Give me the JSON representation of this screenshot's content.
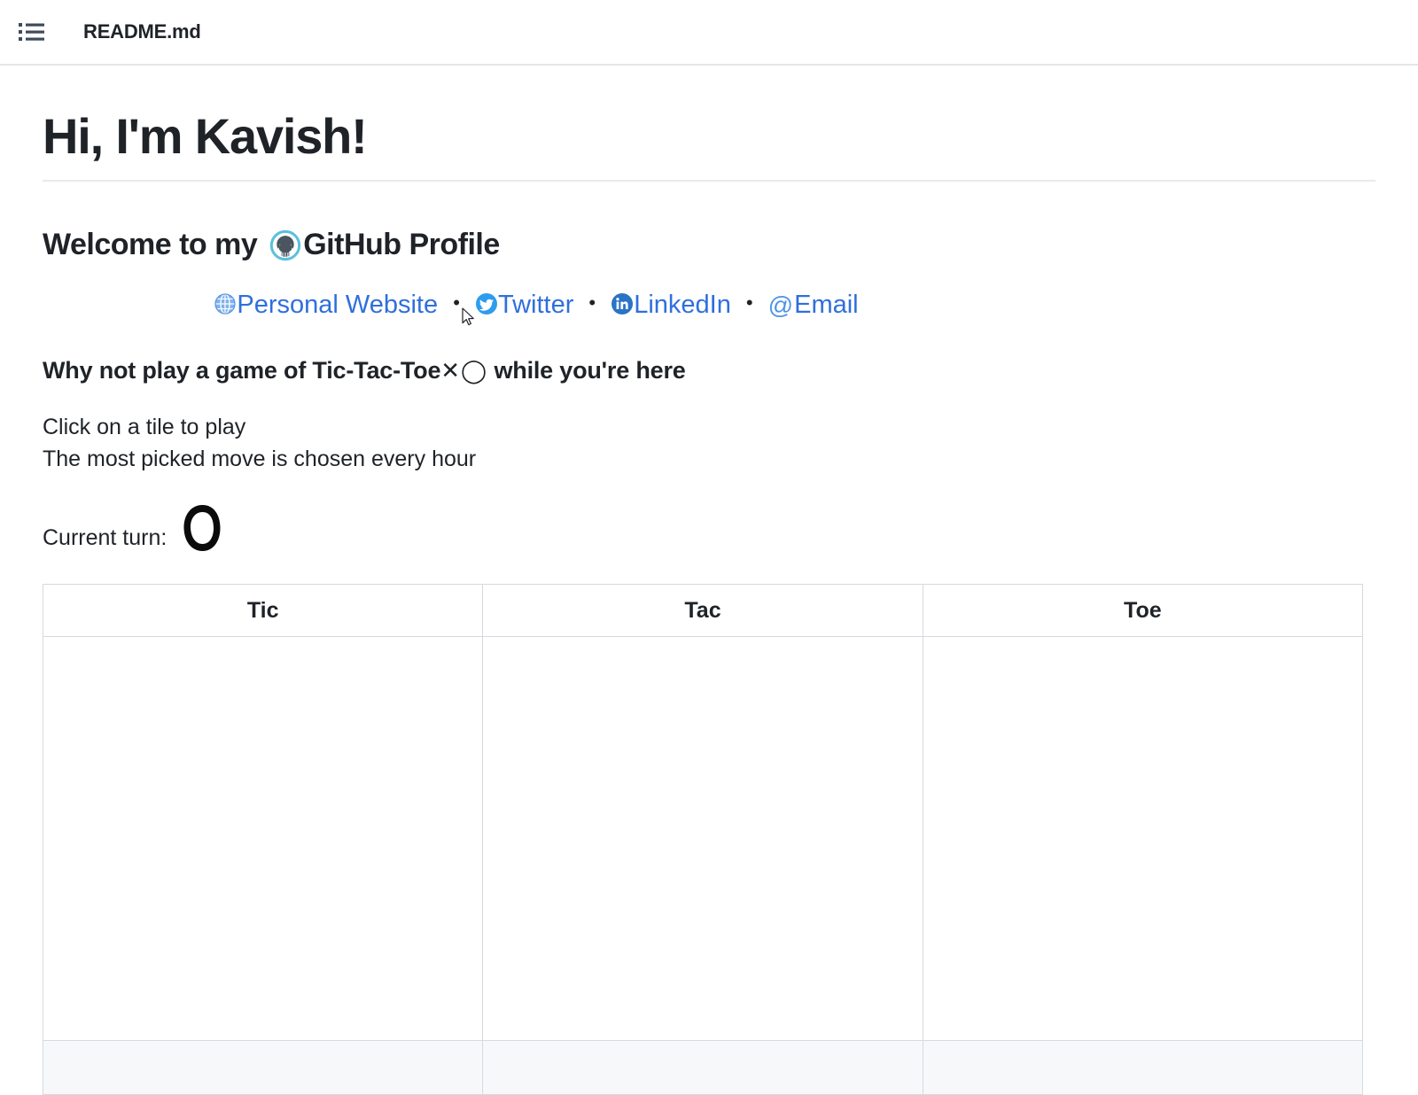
{
  "header": {
    "icon": "list-icon",
    "file_name": "README.md"
  },
  "content": {
    "h1": "Hi, I'm Kavish!",
    "welcome_prefix": "Welcome to my ",
    "github_icon": "github-octocat-icon",
    "welcome_suffix": "GitHub Profile",
    "social_links": [
      {
        "icon": "globe-icon",
        "label": "Personal Website"
      },
      {
        "icon": "twitter-icon",
        "label": "Twitter"
      },
      {
        "icon": "linkedin-icon",
        "label": "LinkedIn"
      },
      {
        "icon": "at-icon",
        "label": "Email"
      }
    ],
    "separator": "•",
    "ttt_heading_prefix": "Why not play a game of Tic-Tac-Toe",
    "ttt_heading_marks": "✕◯",
    "ttt_heading_suffix": "while you're here",
    "instruction_1": "Click on a tile to play",
    "instruction_2": "The most picked move is chosen every hour",
    "current_turn_label": "Current turn:",
    "current_turn_mark": "O"
  },
  "table": {
    "columns": [
      "Tic",
      "Tac",
      "Toe"
    ],
    "rows": [
      [
        "",
        "",
        ""
      ],
      [
        "",
        "",
        ""
      ]
    ]
  },
  "colors": {
    "link_blue": "#2f6fdd",
    "at_blue": "#4f93e8",
    "twitter_blue": "#2d9cee",
    "linkedin_blue": "#2a73c5",
    "github_ring": "#5bc0de",
    "octocat_gray": "#4a5560",
    "border_gray": "#d5dae0",
    "row_alt_bg": "#f6f8fa",
    "text": "#1f2328"
  }
}
